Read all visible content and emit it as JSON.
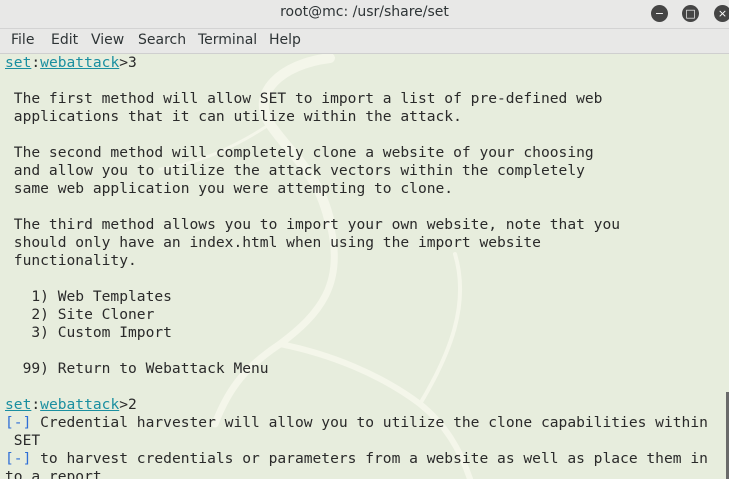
{
  "window": {
    "title": "root@mc: /usr/share/set",
    "minimize_icon": "−",
    "maximize_icon": "□",
    "close_icon": "×"
  },
  "menu": {
    "items": [
      "File",
      "Edit",
      "View",
      "Search",
      "Terminal",
      "Help"
    ]
  },
  "terminal": {
    "prompt1": {
      "set": "set",
      "colon": ":",
      "module": "webattack",
      "rest": ">3"
    },
    "text": [
      " The first method will allow SET to import a list of pre-defined web",
      " applications that it can utilize within the attack.",
      " The second method will completely clone a website of your choosing",
      " and allow you to utilize the attack vectors within the completely",
      " same web application you were attempting to clone.",
      " The third method allows you to import your own website, note that you",
      " should only have an index.html when using the import website",
      " functionality.",
      "   1) Web Templates",
      "   2) Site Cloner",
      "   3) Custom Import",
      "  99) Return to Webattack Menu"
    ],
    "prompt2": {
      "set": "set",
      "colon": ":",
      "module": "webattack",
      "rest": ">2"
    },
    "info": [
      {
        "tag": "[-]",
        "text": " Credential harvester will allow you to utilize the clone capabilities within"
      },
      {
        "tag": "",
        "text": " SET"
      },
      {
        "tag": "[-]",
        "text": " to harvest credentials or parameters from a website as well as place them in"
      },
      {
        "tag": "",
        "text": "to a report"
      }
    ]
  },
  "colors": {
    "terminal_bg": "#e7eddd",
    "prompt": "#1a8fa0",
    "info_tag": "#2f6fd6",
    "text": "#2a2a2a"
  }
}
